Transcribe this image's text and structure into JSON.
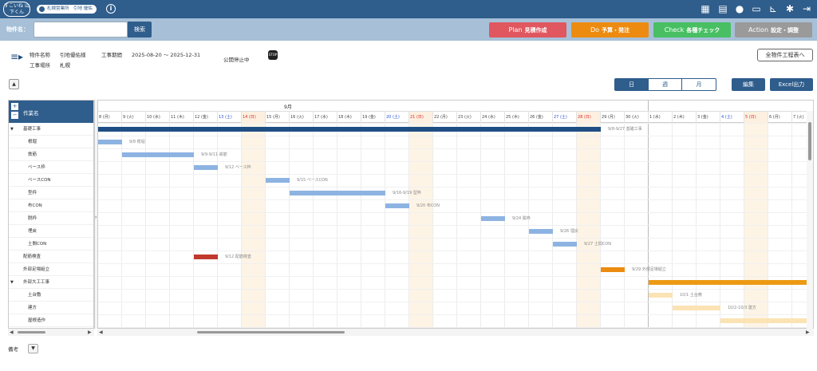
{
  "header": {
    "logo": "すこいね 山下くん",
    "user": "札幌営業所　引地 優佑",
    "icons": [
      "info-icon",
      "building-icon",
      "calendar-icon",
      "chat-icon",
      "folder-icon",
      "chart-icon",
      "gear-icon",
      "logout-icon"
    ]
  },
  "search": {
    "label": "物件名：",
    "value": "",
    "button": "検索"
  },
  "pdca": [
    {
      "big": "Plan",
      "small": "見積作成",
      "color": "#e0575f"
    },
    {
      "big": "Do",
      "small": "予算・発注",
      "color": "#ec8b10"
    },
    {
      "big": "Check",
      "small": "各種チェック",
      "color": "#47bf62"
    },
    {
      "big": "Action",
      "small": "設定・調整",
      "color": "#9a9a9a"
    }
  ],
  "project": {
    "name_label": "物件名称",
    "name_value": "引地優佑様",
    "place_label": "工事場所",
    "place_value": "札幌",
    "period_label": "工事期間",
    "period_value": "2025-08-20 〜 2025-12-31",
    "status": "公開停止中",
    "stop_icon_text": "STOP",
    "all_schedule_button": "全物件工程表へ"
  },
  "view": {
    "day": "日",
    "week": "週",
    "month": "月",
    "edit": "編集",
    "excel": "Excel出力"
  },
  "gantt": {
    "header_label": "作業名",
    "tasks": [
      {
        "name": "基礎工事",
        "group": true,
        "toggle": "▼"
      },
      {
        "name": "根堀",
        "group": false,
        "toggle": ""
      },
      {
        "name": "鉄筋",
        "group": false,
        "toggle": ""
      },
      {
        "name": "ベース枠",
        "group": false,
        "toggle": ""
      },
      {
        "name": "ベースCON",
        "group": false,
        "toggle": ""
      },
      {
        "name": "型枠",
        "group": false,
        "toggle": ""
      },
      {
        "name": "布CON",
        "group": false,
        "toggle": ""
      },
      {
        "name": "脱枠",
        "group": false,
        "toggle": ""
      },
      {
        "name": "埋戻",
        "group": false,
        "toggle": ""
      },
      {
        "name": "土間CON",
        "group": false,
        "toggle": ""
      },
      {
        "name": "配筋検査",
        "group": true,
        "toggle": ""
      },
      {
        "name": "外部足場組立",
        "group": true,
        "toggle": ""
      },
      {
        "name": "外部大工工事",
        "group": true,
        "toggle": "▼"
      },
      {
        "name": "土台敷",
        "group": false,
        "toggle": ""
      },
      {
        "name": "建方",
        "group": false,
        "toggle": ""
      },
      {
        "name": "屋根造作",
        "group": false,
        "toggle": ""
      }
    ],
    "months": [
      {
        "label": "9月"
      }
    ],
    "days": [
      {
        "d": "8 (月)",
        "k": "w"
      },
      {
        "d": "9 (火)",
        "k": "w"
      },
      {
        "d": "10 (水)",
        "k": "w"
      },
      {
        "d": "11 (木)",
        "k": "w"
      },
      {
        "d": "12 (金)",
        "k": "w"
      },
      {
        "d": "13 (土)",
        "k": "sat"
      },
      {
        "d": "14 (日)",
        "k": "sun"
      },
      {
        "d": "15 (月)",
        "k": "w"
      },
      {
        "d": "16 (火)",
        "k": "w"
      },
      {
        "d": "17 (水)",
        "k": "w"
      },
      {
        "d": "18 (木)",
        "k": "w"
      },
      {
        "d": "19 (金)",
        "k": "w"
      },
      {
        "d": "20 (土)",
        "k": "sat"
      },
      {
        "d": "21 (日)",
        "k": "sun"
      },
      {
        "d": "22 (月)",
        "k": "w"
      },
      {
        "d": "23 (火)",
        "k": "w"
      },
      {
        "d": "24 (水)",
        "k": "w"
      },
      {
        "d": "25 (木)",
        "k": "w"
      },
      {
        "d": "26 (金)",
        "k": "w"
      },
      {
        "d": "27 (土)",
        "k": "sat"
      },
      {
        "d": "28 (日)",
        "k": "sun"
      },
      {
        "d": "29 (月)",
        "k": "w"
      },
      {
        "d": "30 (火)",
        "k": "w"
      },
      {
        "d": "1 (水)",
        "k": "w"
      },
      {
        "d": "2 (木)",
        "k": "w"
      },
      {
        "d": "3 (金)",
        "k": "w"
      },
      {
        "d": "4 (土)",
        "k": "sat"
      },
      {
        "d": "5 (日)",
        "k": "sun"
      },
      {
        "d": "6 (月)",
        "k": "w"
      },
      {
        "d": "7 (火)",
        "k": "w"
      }
    ],
    "bars": [
      {
        "row": 0,
        "start": 0,
        "end": 20,
        "color": "#1f4e85",
        "label": "9/8-9/27 基礎工事"
      },
      {
        "row": 1,
        "start": 0,
        "end": 0,
        "color": "#8db3e2",
        "label": "9/8 根堀"
      },
      {
        "row": 2,
        "start": 1,
        "end": 3,
        "color": "#8db3e2",
        "label": "9/9-9/11 鉄筋"
      },
      {
        "row": 3,
        "start": 4,
        "end": 4,
        "color": "#8db3e2",
        "label": "9/12 ベース枠"
      },
      {
        "row": 4,
        "start": 7,
        "end": 7,
        "color": "#8db3e2",
        "label": "9/15 ベースCON"
      },
      {
        "row": 5,
        "start": 8,
        "end": 11,
        "color": "#8db3e2",
        "label": "9/16-9/19 型枠"
      },
      {
        "row": 6,
        "start": 12,
        "end": 12,
        "color": "#8db3e2",
        "label": "9/20 布CON"
      },
      {
        "row": 7,
        "start": 16,
        "end": 16,
        "color": "#8db3e2",
        "label": "9/24 脱枠"
      },
      {
        "row": 8,
        "start": 18,
        "end": 18,
        "color": "#8db3e2",
        "label": "9/26 埋戻"
      },
      {
        "row": 9,
        "start": 19,
        "end": 19,
        "color": "#8db3e2",
        "label": "9/27 土間CON"
      },
      {
        "row": 10,
        "start": 4,
        "end": 4,
        "color": "#c0392b",
        "label": "9/12 配筋検査"
      },
      {
        "row": 11,
        "start": 21,
        "end": 21,
        "color": "#ec8b10",
        "label": "9/29 外部足場組立"
      },
      {
        "row": 12,
        "start": 23,
        "end": 29,
        "color": "#ec9a13",
        "label": ""
      },
      {
        "row": 13,
        "start": 23,
        "end": 23,
        "color": "#fbe3b3",
        "label": "10/1 土台敷"
      },
      {
        "row": 14,
        "start": 24,
        "end": 25,
        "color": "#fbe3b3",
        "label": "10/2-10/3 建方"
      },
      {
        "row": 15,
        "start": 26,
        "end": 29,
        "color": "#fbe3b3",
        "label": "10/4"
      }
    ]
  },
  "footer": {
    "note_label": "備考"
  }
}
